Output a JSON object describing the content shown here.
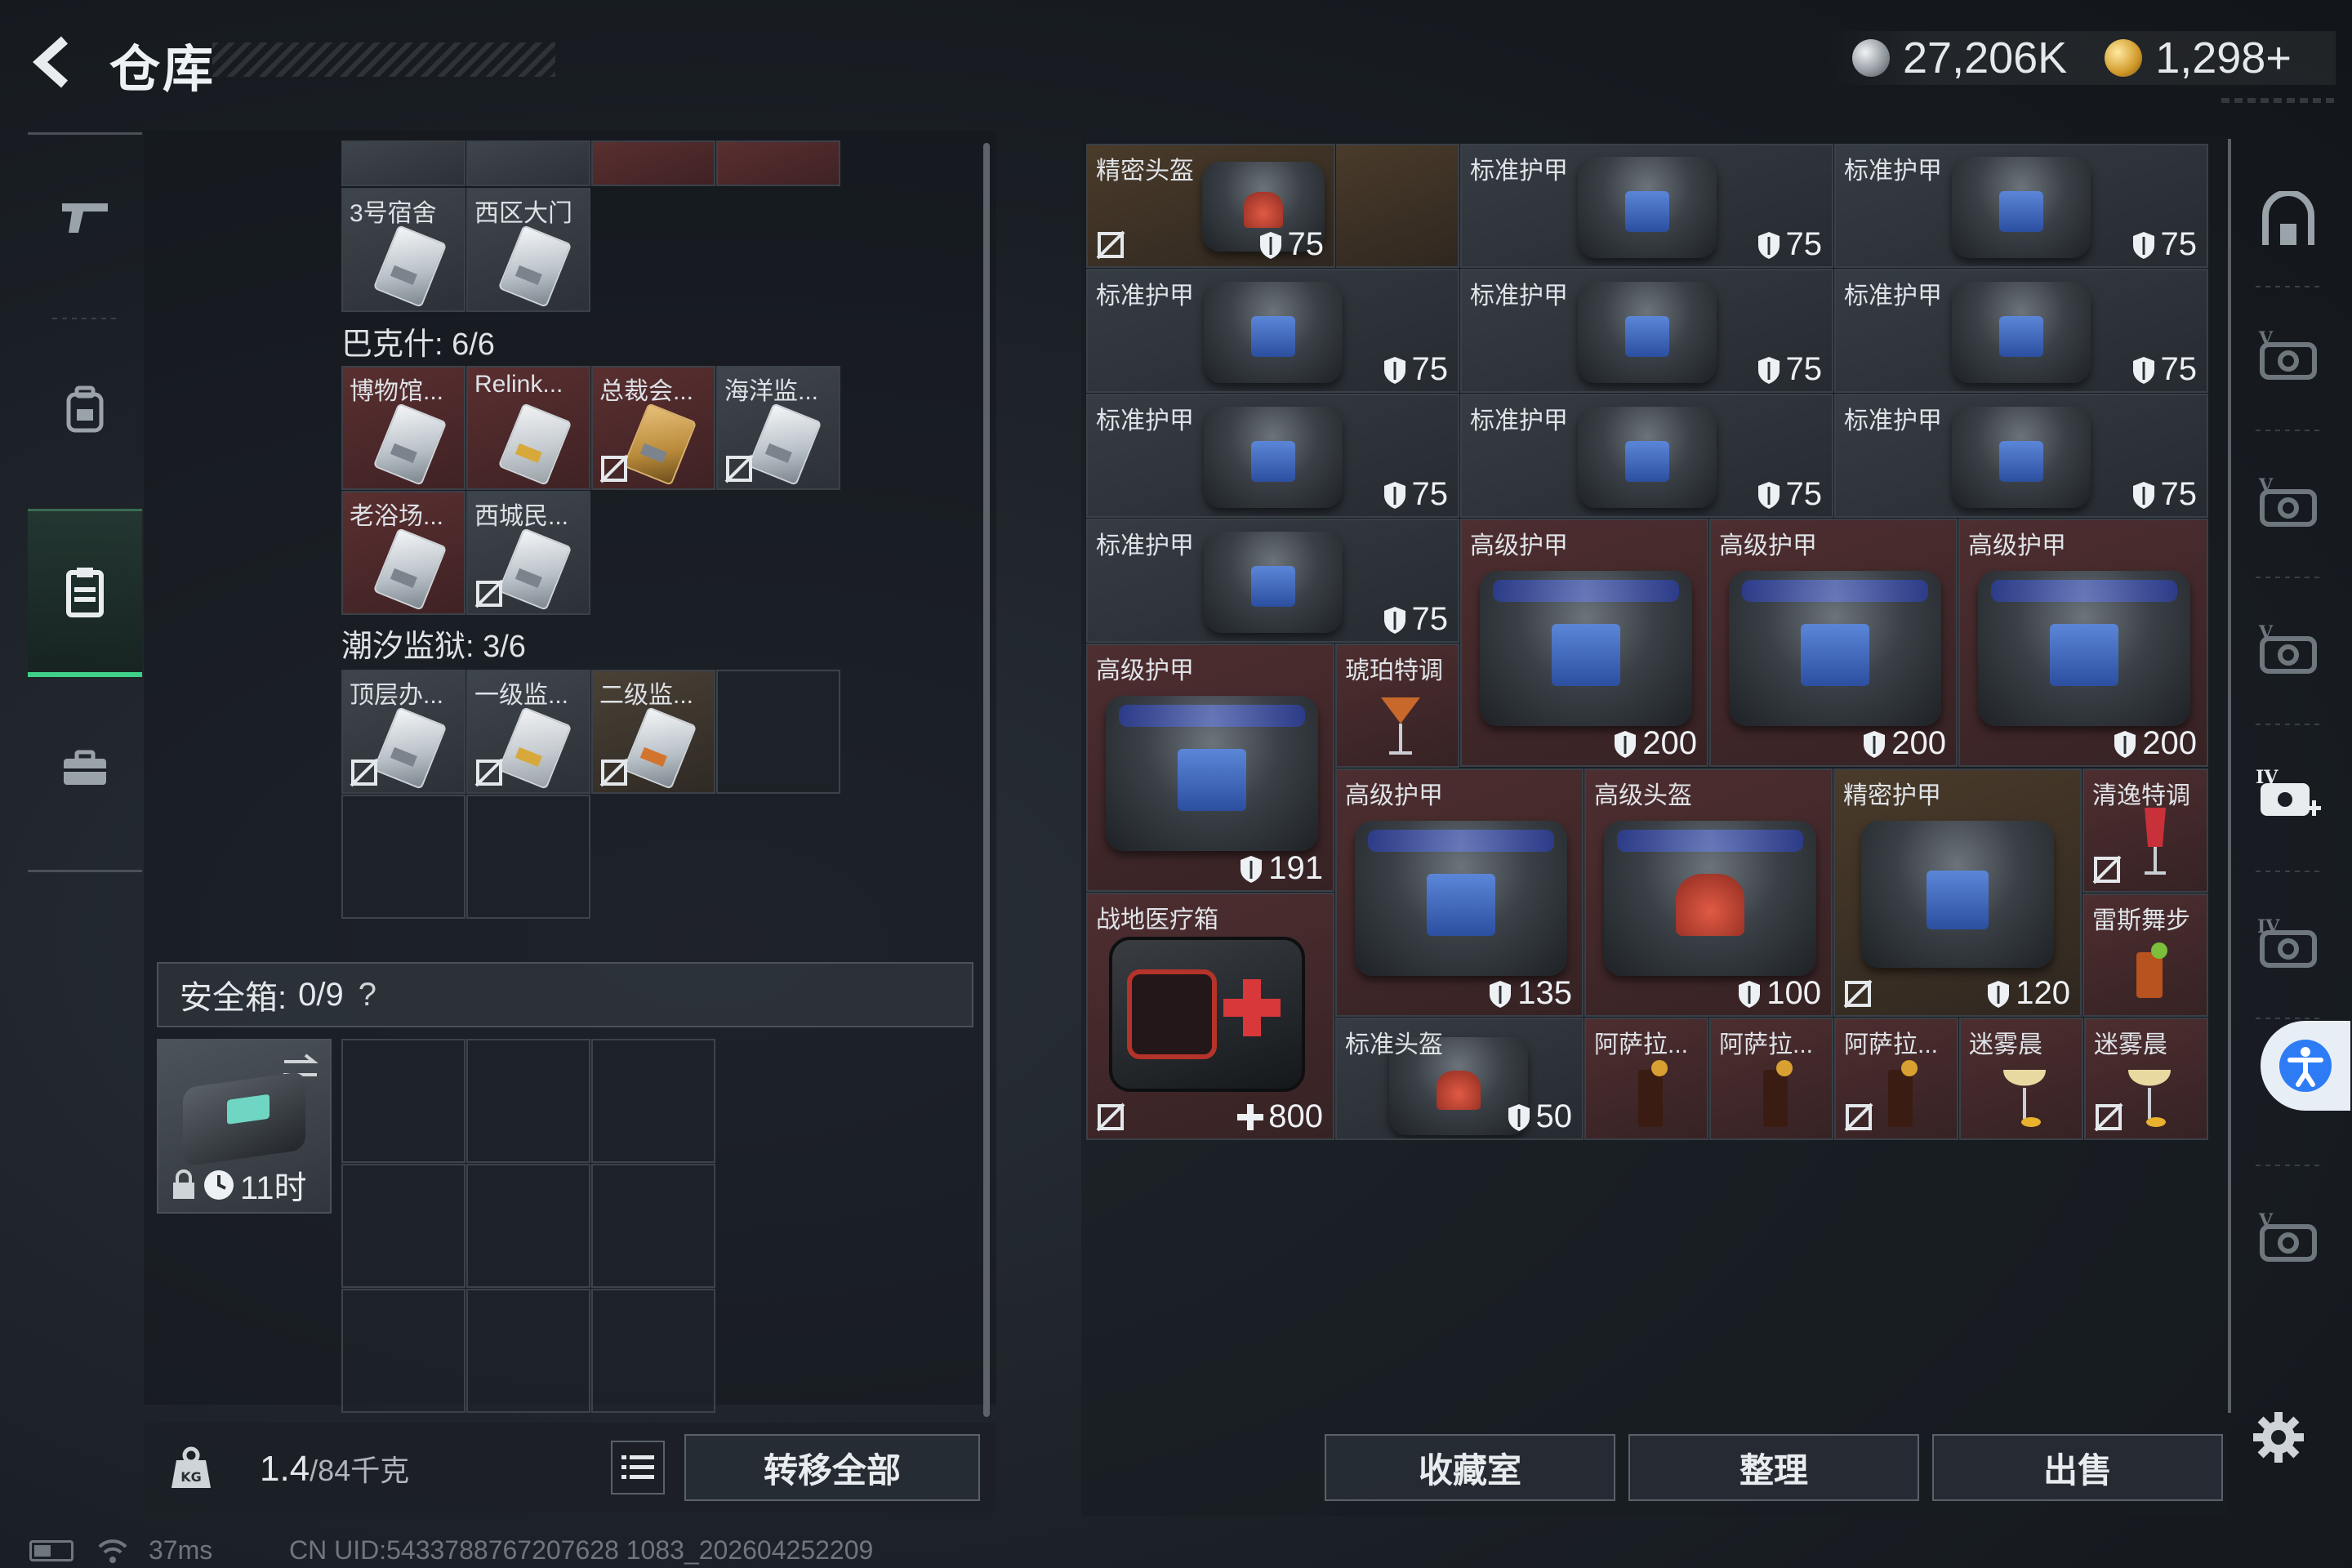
{
  "header": {
    "title": "仓库",
    "currency": [
      {
        "icon": "silver-coin-icon",
        "value": "27,206K"
      },
      {
        "icon": "gold-coin-icon",
        "value": "1,298+"
      }
    ]
  },
  "left_rail": {
    "items": [
      {
        "name": "weapons-tab",
        "icon": "gun-icon"
      },
      {
        "name": "equipment-tab",
        "icon": "backpack-icon"
      },
      {
        "name": "keycards-tab",
        "icon": "clipboard-icon",
        "active": true
      },
      {
        "name": "toolbox-tab",
        "icon": "briefcase-icon"
      }
    ]
  },
  "inventory": {
    "top_cards": [
      {
        "label": "3号宿舍"
      },
      {
        "label": "西区大门"
      }
    ],
    "sections": [
      {
        "title": "巴克什: 6/6",
        "cards": [
          {
            "label": "博物馆..."
          },
          {
            "label": "Relink..."
          },
          {
            "label": "总裁会..."
          },
          {
            "label": "海洋监..."
          },
          {
            "label": "老浴场..."
          },
          {
            "label": "西城民..."
          }
        ]
      },
      {
        "title": "潮汐监狱: 3/6",
        "cards": [
          {
            "label": "顶层办..."
          },
          {
            "label": "一级监..."
          },
          {
            "label": "二级监..."
          }
        ]
      }
    ],
    "safebox": {
      "label": "安全箱:",
      "count": "0/9",
      "help": "?",
      "timer": "11时"
    },
    "weight": {
      "current": "1.4",
      "max": "/84千克"
    },
    "transfer_all": "转移全部"
  },
  "stash": {
    "items": [
      {
        "label": "精密头盔",
        "value": "75"
      },
      {
        "label": "标准护甲",
        "value": "75"
      },
      {
        "label": "标准护甲",
        "value": "75"
      },
      {
        "label": "标准护甲",
        "value": "75"
      },
      {
        "label": "标准护甲",
        "value": "75"
      },
      {
        "label": "标准护甲",
        "value": "75"
      },
      {
        "label": "标准护甲",
        "value": "75"
      },
      {
        "label": "标准护甲",
        "value": "75"
      },
      {
        "label": "标准护甲",
        "value": "75"
      },
      {
        "label": "标准护甲",
        "value": "75"
      },
      {
        "label": "高级护甲",
        "value": "200"
      },
      {
        "label": "高级护甲",
        "value": "200"
      },
      {
        "label": "高级护甲",
        "value": "200"
      },
      {
        "label": "高级护甲",
        "value": "191"
      },
      {
        "label": "琥珀特调",
        "value": ""
      },
      {
        "label": "高级护甲",
        "value": "135"
      },
      {
        "label": "高级头盔",
        "value": "100"
      },
      {
        "label": "精密护甲",
        "value": "120"
      },
      {
        "label": "清逸特调",
        "value": ""
      },
      {
        "label": "雷斯舞步",
        "value": ""
      },
      {
        "label": "战地医疗箱",
        "value": "800"
      },
      {
        "label": "标准头盔",
        "value": "50"
      },
      {
        "label": "阿萨拉...",
        "value": ""
      },
      {
        "label": "阿萨拉...",
        "value": ""
      },
      {
        "label": "阿萨拉...",
        "value": ""
      },
      {
        "label": "迷雾晨",
        "value": ""
      },
      {
        "label": "迷雾晨",
        "value": ""
      }
    ],
    "buttons": {
      "collection": "收藏室",
      "organize": "整理",
      "sell": "出售"
    }
  },
  "status_bar": {
    "ping": "37ms",
    "uid": "CN UID:5433788767207628 1083_202604252209"
  }
}
